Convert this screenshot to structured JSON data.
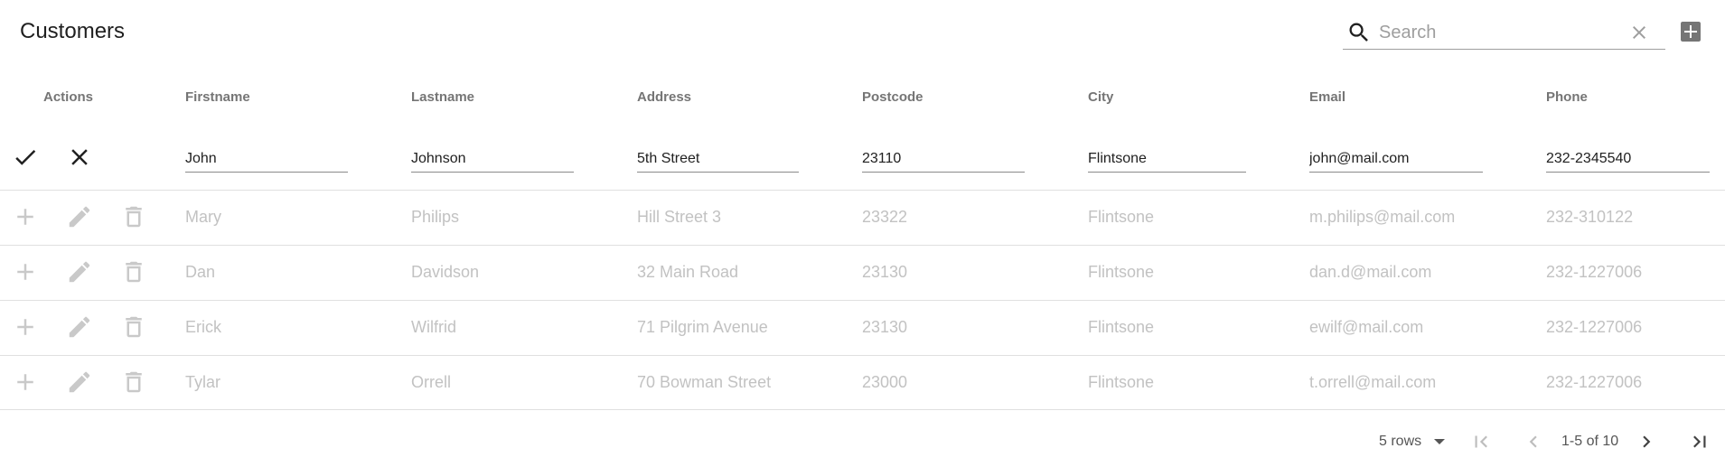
{
  "toolbar": {
    "title": "Customers",
    "search_placeholder": "Search",
    "search_value": ""
  },
  "columns": {
    "actions": "Actions",
    "firstname": "Firstname",
    "lastname": "Lastname",
    "address": "Address",
    "postcode": "Postcode",
    "city": "City",
    "email": "Email",
    "phone": "Phone"
  },
  "edit_row": {
    "firstname": "John",
    "lastname": "Johnson",
    "address": "5th Street",
    "postcode": "23110",
    "city": "Flintsone",
    "email": "john@mail.com",
    "phone": "232-2345540"
  },
  "rows": [
    {
      "firstname": "Mary",
      "lastname": "Philips",
      "address": "Hill Street 3",
      "postcode": "23322",
      "city": "Flintsone",
      "email": "m.philips@mail.com",
      "phone": "232-310122"
    },
    {
      "firstname": "Dan",
      "lastname": "Davidson",
      "address": "32 Main Road",
      "postcode": "23130",
      "city": "Flintsone",
      "email": "dan.d@mail.com",
      "phone": "232-1227006"
    },
    {
      "firstname": "Erick",
      "lastname": "Wilfrid",
      "address": "71 Pilgrim Avenue",
      "postcode": "23130",
      "city": "Flintsone",
      "email": "ewilf@mail.com",
      "phone": "232-1227006"
    },
    {
      "firstname": "Tylar",
      "lastname": "Orrell",
      "address": "70 Bowman Street",
      "postcode": "23000",
      "city": "Flintsone",
      "email": "t.orrell@mail.com",
      "phone": "232-1227006"
    }
  ],
  "pagination": {
    "rows_per_page": "5 rows",
    "range": "1-5 of 10"
  },
  "icons": {
    "toolbar": [
      "search-icon",
      "close-icon",
      "add-box-icon"
    ],
    "edit_row": [
      "check-icon",
      "close-icon"
    ],
    "row_actions": [
      "add-icon",
      "edit-icon",
      "delete-icon"
    ],
    "pager": [
      "first-page-icon",
      "chevron-left-icon",
      "chevron-right-icon",
      "last-page-icon",
      "arrow-drop-down-icon"
    ]
  },
  "colors": {
    "text_primary": "#212121",
    "text_disabled": "#c2c2c2",
    "header_text": "#757575",
    "divider": "#e0e0e0"
  }
}
